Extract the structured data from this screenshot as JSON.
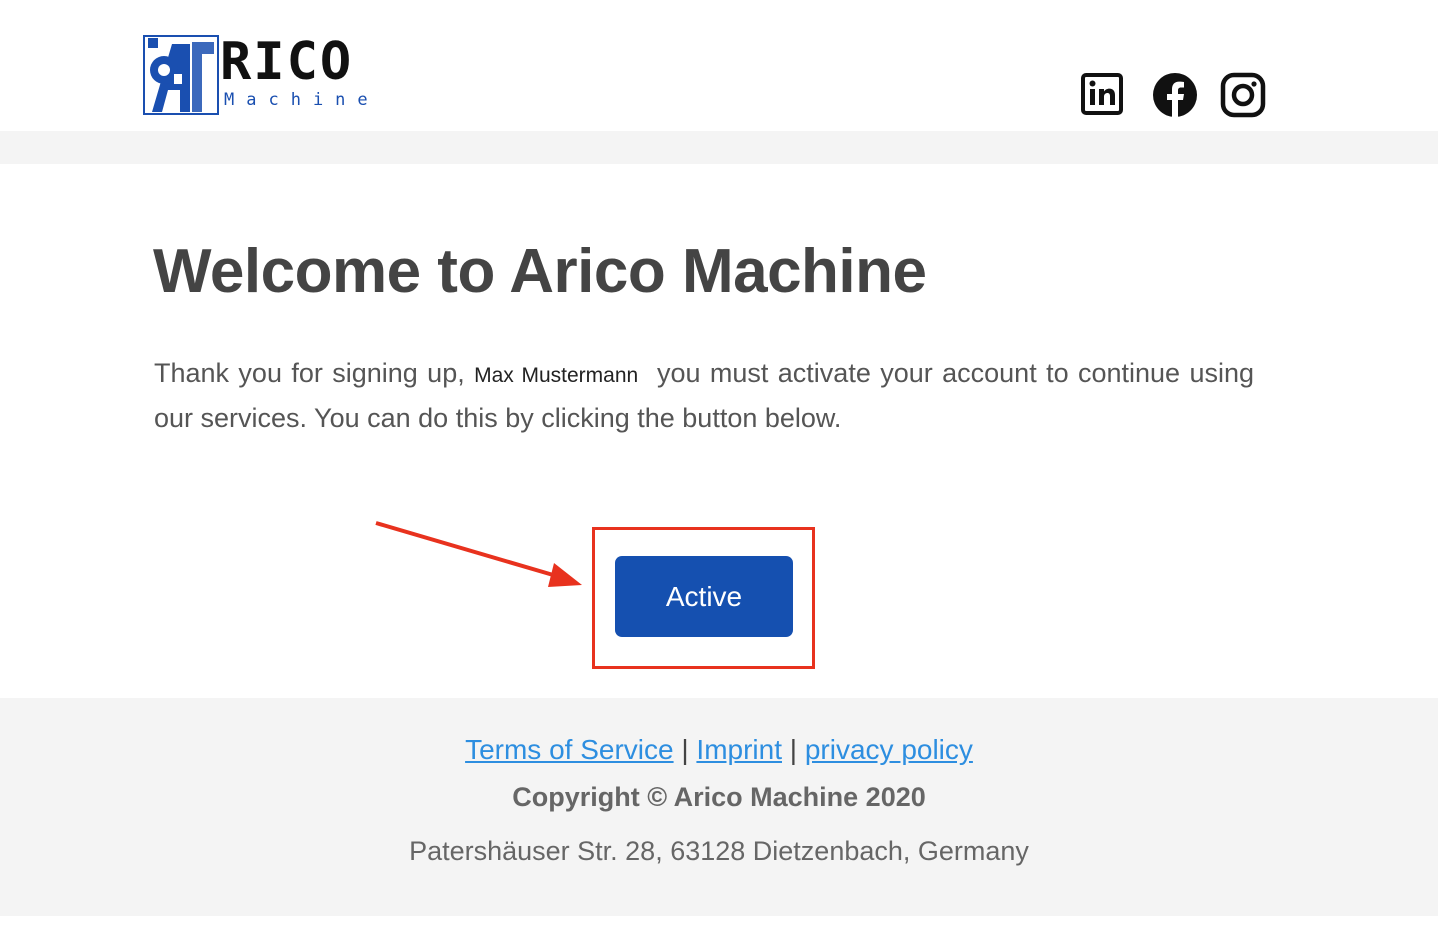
{
  "header": {
    "logo": {
      "word": "RICO",
      "subword": "Machine",
      "brand_color": "#1a4fb0"
    },
    "socials": [
      {
        "icon": "linkedin-icon"
      },
      {
        "icon": "facebook-icon"
      },
      {
        "icon": "instagram-icon"
      }
    ]
  },
  "main": {
    "title": "Welcome to Arico Machine",
    "intro_before": "Thank you for signing up,",
    "user_name": "Max Mustermann",
    "intro_after": "you must activate your account to continue using our services. You can do this by clicking the button below.",
    "activate_label": "Active",
    "button_color": "#1550b0",
    "highlight_color": "#e8321e"
  },
  "footer": {
    "links": [
      "Terms of Service",
      "Imprint",
      "privacy policy"
    ],
    "separator": "|",
    "copyright": "Copyright © Arico Machine 2020",
    "address": "Patershäuser Str. 28, 63128 Dietzenbach, Germany"
  }
}
